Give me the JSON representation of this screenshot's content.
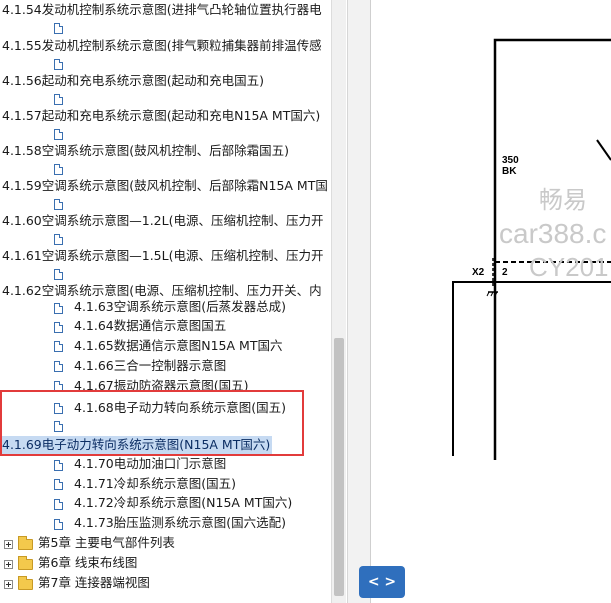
{
  "tree": {
    "items": [
      {
        "label": "4.1.54发动机控制系统示意图(进排气凸轮轴位置执行器电",
        "selected": false
      },
      {
        "label": "4.1.55发动机控制系统示意图(排气颗粒捕集器前排温传感",
        "selected": false
      },
      {
        "label": "4.1.56起动和充电系统示意图(起动和充电国五)",
        "selected": false
      },
      {
        "label": "4.1.57起动和充电系统示意图(起动和充电N15A MT国六)",
        "selected": false
      },
      {
        "label": "4.1.58空调系统示意图(鼓风机控制、后部除霜国五)",
        "selected": false
      },
      {
        "label": "4.1.59空调系统示意图(鼓风机控制、后部除霜N15A MT国",
        "selected": false
      },
      {
        "label": "4.1.60空调系统示意图—1.2L(电源、压缩机控制、压力开",
        "selected": false
      },
      {
        "label": "4.1.61空调系统示意图—1.5L(电源、压缩机控制、压力开",
        "selected": false
      },
      {
        "label": "4.1.62空调系统示意图(电源、压缩机控制、压力开关、内",
        "selected": false
      }
    ],
    "nested_items": [
      {
        "label": "4.1.63空调系统示意图(后蒸发器总成)"
      },
      {
        "label": "4.1.64数据通信示意图国五"
      },
      {
        "label": "4.1.65数据通信示意图N15A MT国六"
      },
      {
        "label": "4.1.66三合一控制器示意图"
      },
      {
        "label": "4.1.67振动防盗器示意图(国五)"
      },
      {
        "label": "4.1.68电子动力转向系统示意图(国五)"
      }
    ],
    "selected_item": {
      "label": "4.1.69电子动力转向系统示意图(N15A MT国六)"
    },
    "after_items": [
      {
        "label": "4.1.70电动加油口门示意图"
      },
      {
        "label": "4.1.71冷却系统示意图(国五)"
      },
      {
        "label": "4.1.72冷却系统示意图(N15A MT国六)"
      },
      {
        "label": "4.1.73胎压监测系统示意图(国六选配)"
      }
    ],
    "chapters": [
      {
        "label": "第5章 主要电气部件列表",
        "icon": "folder-icon"
      },
      {
        "label": "第6章 线束布线图",
        "icon": "folder-icon"
      },
      {
        "label": "第7章 连接器端视图",
        "icon": "folder-icon"
      }
    ]
  },
  "diagram": {
    "wire_label_top": "350",
    "wire_label_bottom": "BK",
    "connector_label": "X2",
    "pin_label": "2",
    "watermark_line1": "畅易",
    "watermark_line2": "car388.c",
    "watermark_line3": "CY201"
  },
  "toolbar": {
    "toggle_label": "< >"
  },
  "colors": {
    "highlight": "#c6daf2",
    "annotation": "#e23b3b",
    "button": "#2f6fbd"
  }
}
